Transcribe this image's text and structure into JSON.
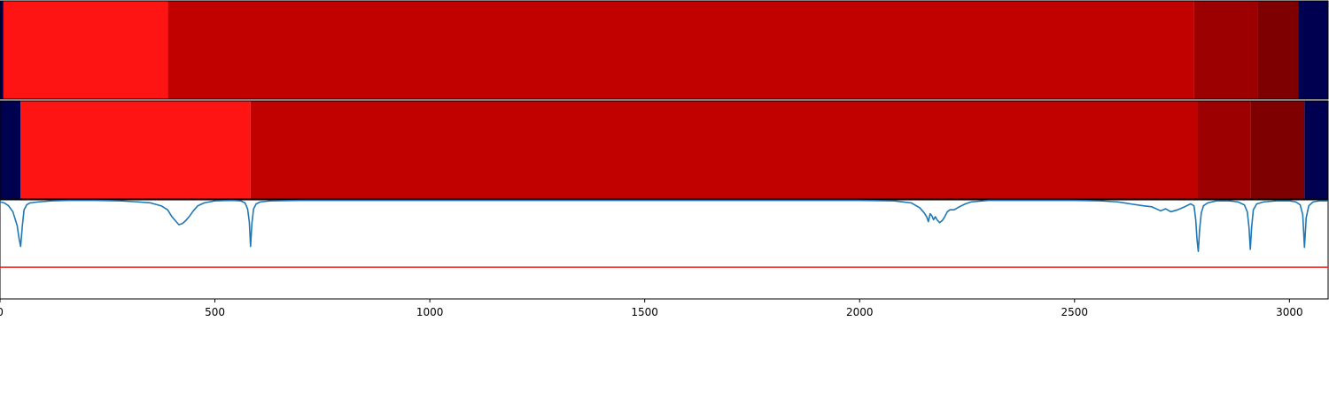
{
  "chart_data": [
    {
      "type": "heatmap",
      "title": "",
      "xlim": [
        0,
        3090
      ],
      "segments": [
        {
          "x0": 0,
          "x1": 8,
          "color": "#000051"
        },
        {
          "x0": 8,
          "x1": 390,
          "color": "#ff1414"
        },
        {
          "x0": 390,
          "x1": 2778,
          "color": "#c10000"
        },
        {
          "x0": 2778,
          "x1": 2926,
          "color": "#9c0000"
        },
        {
          "x0": 2926,
          "x1": 3021,
          "color": "#7f0000"
        },
        {
          "x0": 3021,
          "x1": 3090,
          "color": "#000051"
        }
      ]
    },
    {
      "type": "heatmap",
      "title": "",
      "xlim": [
        0,
        3090
      ],
      "segments": [
        {
          "x0": 0,
          "x1": 48,
          "color": "#000051"
        },
        {
          "x0": 48,
          "x1": 583,
          "color": "#ff1414"
        },
        {
          "x0": 583,
          "x1": 2787,
          "color": "#c10000"
        },
        {
          "x0": 2787,
          "x1": 2909,
          "color": "#9c0000"
        },
        {
          "x0": 2909,
          "x1": 3035,
          "color": "#7f0000"
        },
        {
          "x0": 3035,
          "x1": 3090,
          "color": "#000051"
        }
      ]
    },
    {
      "type": "line",
      "title": "",
      "xlabel": "",
      "ylabel": "",
      "xlim": [
        0,
        3090
      ],
      "ylim": [
        -1.0,
        0.0
      ],
      "xticks": [
        0,
        500,
        1000,
        1500,
        2000,
        2500,
        3000
      ],
      "xtick_labels": [
        "0",
        "500",
        "1000",
        "1500",
        "2000",
        "2500",
        "3000"
      ],
      "threshold": {
        "y": -0.68,
        "color": "#e8231f"
      },
      "series": [
        {
          "color": "#1f77b4",
          "x": [
            0,
            10,
            20,
            30,
            40,
            44,
            48,
            52,
            56,
            62,
            70,
            90,
            120,
            160,
            220,
            280,
            320,
            350,
            375,
            390,
            400,
            408,
            416,
            424,
            432,
            440,
            450,
            460,
            475,
            500,
            540,
            560,
            570,
            576,
            580,
            583,
            586,
            590,
            596,
            606,
            630,
            700,
            1000,
            1500,
            2000,
            2080,
            2120,
            2140,
            2150,
            2156,
            2160,
            2164,
            2168,
            2172,
            2176,
            2180,
            2186,
            2192,
            2198,
            2204,
            2210,
            2220,
            2232,
            2246,
            2260,
            2300,
            2400,
            2500,
            2560,
            2600,
            2630,
            2660,
            2680,
            2690,
            2700,
            2712,
            2724,
            2740,
            2756,
            2770,
            2778,
            2782,
            2785,
            2788,
            2791,
            2795,
            2800,
            2810,
            2830,
            2860,
            2880,
            2895,
            2902,
            2906,
            2909,
            2912,
            2916,
            2924,
            2940,
            2970,
            3000,
            3015,
            3025,
            3031,
            3035,
            3039,
            3045,
            3055,
            3070,
            3090
          ],
          "y": [
            -0.02,
            -0.03,
            -0.06,
            -0.12,
            -0.26,
            -0.38,
            -0.47,
            -0.26,
            -0.1,
            -0.05,
            -0.03,
            -0.02,
            -0.01,
            -0.005,
            -0.005,
            -0.01,
            -0.02,
            -0.03,
            -0.06,
            -0.1,
            -0.17,
            -0.21,
            -0.25,
            -0.24,
            -0.21,
            -0.17,
            -0.11,
            -0.06,
            -0.03,
            -0.01,
            -0.005,
            -0.01,
            -0.03,
            -0.09,
            -0.22,
            -0.47,
            -0.24,
            -0.09,
            -0.04,
            -0.02,
            -0.01,
            -0.005,
            -0.005,
            -0.005,
            -0.005,
            -0.01,
            -0.03,
            -0.08,
            -0.13,
            -0.17,
            -0.22,
            -0.14,
            -0.16,
            -0.2,
            -0.17,
            -0.2,
            -0.23,
            -0.21,
            -0.17,
            -0.12,
            -0.1,
            -0.1,
            -0.07,
            -0.04,
            -0.02,
            -0.005,
            -0.005,
            -0.005,
            -0.01,
            -0.02,
            -0.04,
            -0.06,
            -0.07,
            -0.09,
            -0.11,
            -0.09,
            -0.12,
            -0.1,
            -0.07,
            -0.04,
            -0.06,
            -0.2,
            -0.4,
            -0.52,
            -0.3,
            -0.13,
            -0.06,
            -0.03,
            -0.01,
            -0.01,
            -0.02,
            -0.05,
            -0.12,
            -0.28,
            -0.5,
            -0.28,
            -0.1,
            -0.04,
            -0.02,
            -0.01,
            -0.01,
            -0.02,
            -0.05,
            -0.15,
            -0.48,
            -0.18,
            -0.06,
            -0.02,
            -0.01,
            -0.01
          ]
        }
      ]
    }
  ]
}
